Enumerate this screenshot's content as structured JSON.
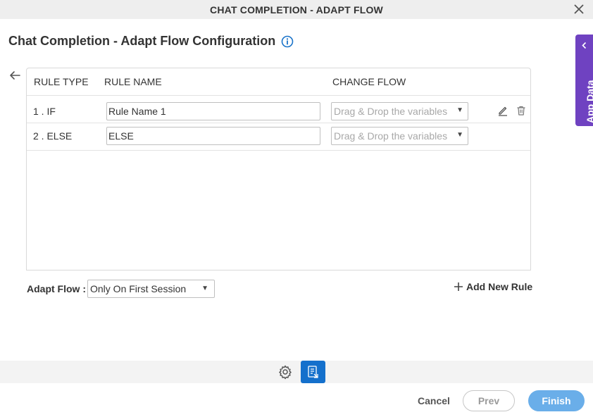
{
  "window": {
    "title": "CHAT COMPLETION - ADAPT FLOW"
  },
  "page": {
    "title": "Chat Completion - Adapt Flow Configuration"
  },
  "table": {
    "headers": {
      "rule_type": "RULE TYPE",
      "rule_name": "RULE NAME",
      "change_flow": "CHANGE FLOW"
    },
    "rows": [
      {
        "type": "1 . IF",
        "name": "Rule Name 1",
        "flow_placeholder": "Drag & Drop the variables"
      },
      {
        "type": "2 . ELSE",
        "name": "ELSE",
        "flow_placeholder": "Drag & Drop the variables"
      }
    ]
  },
  "adapt_flow": {
    "label": "Adapt Flow :",
    "selected": "Only On First Session"
  },
  "add_rule_label": "Add New Rule",
  "side_panel": {
    "label": "App Data"
  },
  "footer": {
    "cancel": "Cancel",
    "prev": "Prev",
    "finish": "Finish"
  },
  "colors": {
    "accent_purple": "#6f42c1",
    "primary_blue": "#1470cc",
    "finish_blue": "#6aaee9",
    "info_blue": "#1a73c9"
  }
}
